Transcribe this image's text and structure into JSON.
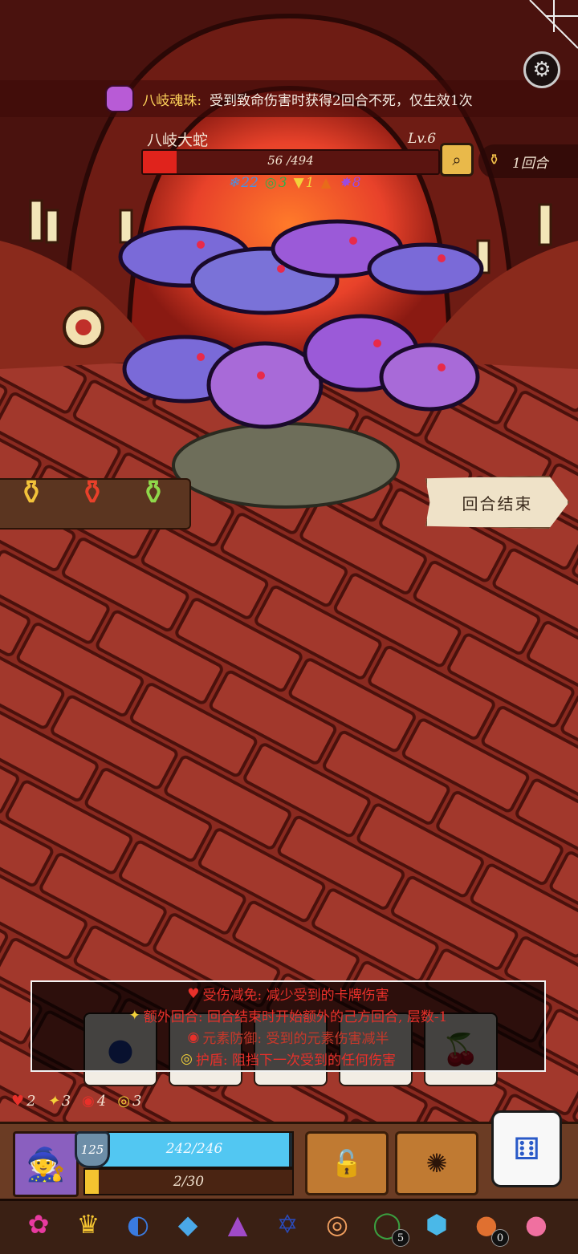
{
  "relic_banner": {
    "name": "八岐魂珠",
    "separator": ":",
    "desc": "受到致命伤害时获得2回合不死，仅生效1次"
  },
  "boss": {
    "name": "八岐大蛇",
    "level": "Lv.6",
    "hp_text": "56 /494",
    "hp_current": 56,
    "hp_max": 494,
    "intents": [
      {
        "icon": "snowflake-icon",
        "glyph": "❄",
        "value": "22",
        "color": "#4a90e2"
      },
      {
        "icon": "swirl-icon",
        "glyph": "◎",
        "value": "3",
        "color": "#2fb04a"
      },
      {
        "icon": "triangle-icon",
        "glyph": "▼",
        "value": "1",
        "color": "#f2d23a"
      },
      {
        "icon": "flame-icon",
        "glyph": "▲",
        "value": "",
        "color": "#e86b1a"
      },
      {
        "icon": "virus-icon",
        "glyph": "✸",
        "value": "8",
        "color": "#9b4be0"
      }
    ]
  },
  "turn": {
    "icon": "broom-icon",
    "label": "1回合"
  },
  "potions": [
    {
      "name": "yellow-potion-icon",
      "glyph": "⚱",
      "color": "#f2c23a"
    },
    {
      "name": "red-potion-icon",
      "glyph": "⚱",
      "color": "#e8402a"
    },
    {
      "name": "green-potion-icon",
      "glyph": "⚱",
      "color": "#8fd84a"
    }
  ],
  "end_turn_label": "回合结束",
  "cards": [
    {
      "name": "blueberry-card",
      "glyph": "●",
      "color": "#1d3ea8"
    },
    {
      "name": "card-2",
      "glyph": "",
      "color": "#333"
    },
    {
      "name": "card-3",
      "glyph": "",
      "color": "#333"
    },
    {
      "name": "card-4",
      "glyph": "",
      "color": "#333"
    },
    {
      "name": "cherry-card",
      "glyph": "🍒",
      "color": "#c02020"
    }
  ],
  "tooltip": [
    {
      "icon": "heart-shield-icon",
      "glyph": "♥",
      "icon_color": "#e8302a",
      "text": "受伤减免: 减少受到的卡牌伤害"
    },
    {
      "icon": "star-icon",
      "glyph": "✦",
      "icon_color": "#f4d23a",
      "text": "额外回合: 回合结束时开始额外的己方回合, 层数-1"
    },
    {
      "icon": "element-defense-icon",
      "glyph": "◉",
      "icon_color": "#e8302a",
      "text": "元素防御: 受到的元素伤害减半"
    },
    {
      "icon": "shield-icon",
      "glyph": "◎",
      "icon_color": "#f4d23a",
      "text": "护盾: 阻挡下一次受到的任何伤害"
    }
  ],
  "statuses": [
    {
      "icon": "heart-shield-icon",
      "glyph": "♥",
      "color": "#e8302a",
      "value": "2"
    },
    {
      "icon": "star-icon",
      "glyph": "✦",
      "color": "#f4d23a",
      "value": "3"
    },
    {
      "icon": "element-defense-icon",
      "glyph": "◉",
      "color": "#e8302a",
      "value": "4"
    },
    {
      "icon": "shield-icon",
      "glyph": "◎",
      "color": "#f4d23a",
      "value": "3"
    }
  ],
  "player": {
    "armor": "125",
    "mp_text": "242/246",
    "mp_current": 242,
    "mp_max": 246,
    "xp_text": "2/30",
    "xp_current": 2,
    "xp_max": 30
  },
  "relics": [
    {
      "name": "pink-bird-icon",
      "glyph": "✿",
      "color": "#e83aa0",
      "count": ""
    },
    {
      "name": "crown-icon",
      "glyph": "♛",
      "color": "#f4c430",
      "count": ""
    },
    {
      "name": "blue-snail-icon",
      "glyph": "◐",
      "color": "#3a7be0",
      "count": ""
    },
    {
      "name": "blue-book-icon",
      "glyph": "◆",
      "color": "#4aa8e8",
      "count": ""
    },
    {
      "name": "eye-flask-icon",
      "glyph": "▲",
      "color": "#a04ac8",
      "count": ""
    },
    {
      "name": "hexagram-icon",
      "glyph": "✡",
      "color": "#2a4ab8",
      "count": ""
    },
    {
      "name": "donut-icon",
      "glyph": "◎",
      "color": "#f2a060",
      "count": ""
    },
    {
      "name": "green-ring-icon",
      "glyph": "◯",
      "color": "#3aa040",
      "count": "5"
    },
    {
      "name": "blue-gem-icon",
      "glyph": "⬢",
      "color": "#4ab8e8",
      "count": ""
    },
    {
      "name": "cookie-icon",
      "glyph": "●",
      "color": "#e07030",
      "count": "0"
    },
    {
      "name": "pink-seed-icon",
      "glyph": "●",
      "color": "#f070a0",
      "count": ""
    }
  ]
}
